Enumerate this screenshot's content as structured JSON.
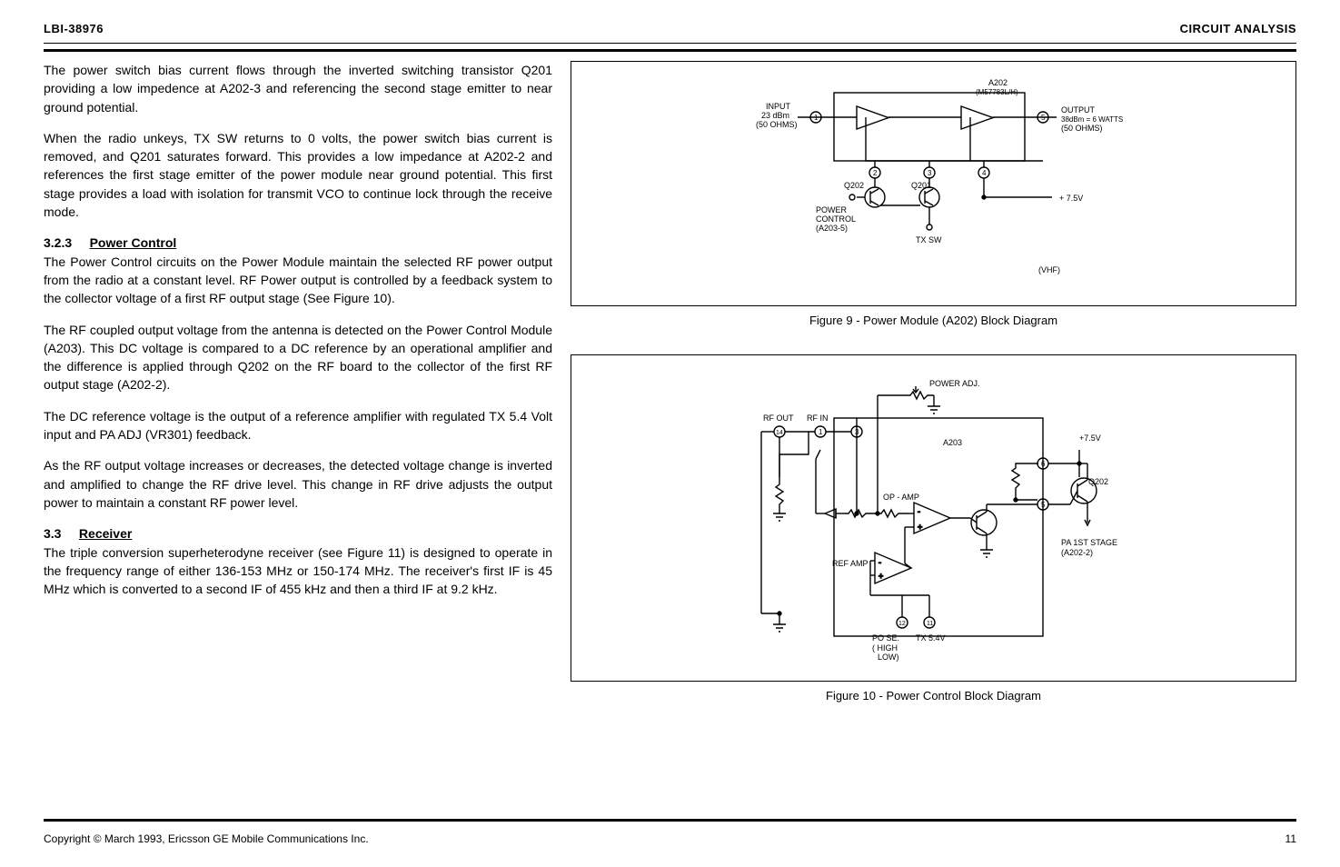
{
  "header": {
    "left": "LBI-38976",
    "right": "CIRCUIT ANALYSIS"
  },
  "body": {
    "p1": "The power switch bias current flows through the inverted switching transistor Q201 providing a low impedence at A202-3 and referencing the second stage emitter to near ground potential.",
    "p2": "When the radio unkeys, TX SW returns to 0 volts, the power switch bias current is removed, and Q201 saturates forward. This provides a low impedance at A202-2 and references the first stage emitter of the power module near ground potential. This first stage provides a load with isolation for transmit VCO to continue lock through the receive mode.",
    "h_sec": "3.2.3",
    "h_title": "Power Control",
    "p3": "The Power Control circuits on the Power Module maintain the selected RF power output from the radio at a constant level. RF Power output is controlled by a feedback system to the collector voltage of a first RF output stage (See Figure 10).",
    "p4": "The RF coupled output voltage from the antenna is detected on the Power Control Module (A203). This DC voltage is compared to a DC reference by an operational amplifier and the difference is applied through Q202 on the RF board to the collector of the first RF output stage (A202-2).",
    "p5": "The DC reference voltage is the output of a reference amplifier with regulated TX 5.4 Volt input and PA ADJ (VR301) feedback.",
    "p6": "As the RF output voltage increases or decreases, the detected voltage change is inverted and amplified to change the RF drive level. This change in RF drive adjusts the output power to maintain a constant RF power level.",
    "h_sec2": "3.3",
    "h_title2": "Receiver",
    "p7": "The triple conversion superheterodyne receiver (see Figure 11) is designed to operate in the frequency range of either 136-153 MHz or 150-174 MHz. The receiver's first IF is 45 MHz which is converted to a second IF of 455 kHz and then a third IF at 9.2 kHz."
  },
  "fig9": {
    "caption": "Figure 9 - Power Module (A202) Block Diagram",
    "labels": {
      "a202": "A202",
      "part": "(M57783L/H)",
      "input": "INPUT",
      "input_dbm": "23 dBm",
      "input_ohms": "(50 OHMS)",
      "output": "OUTPUT",
      "output_dbm": "38dBm = 6 WATTS",
      "output_ohms": "(50 OHMS)",
      "q202": "Q202",
      "q201": "Q201",
      "power_control": "POWER",
      "power_control2": "CONTROL",
      "a203_5": "(A203-5)",
      "tx_sw": "TX SW",
      "v75": "+ 7.5V",
      "vhf": "(VHF)"
    }
  },
  "fig10": {
    "caption": "Figure 10 - Power Control Block Diagram",
    "labels": {
      "rf_out": "RF OUT",
      "rf_in": "RF IN",
      "power_adj": "POWER ADJ.",
      "a203": "A203",
      "opamp": "OP - AMP",
      "refamp": "REF AMP",
      "q202": "Q202",
      "v75": "+7.5V",
      "pa1st": "PA 1ST STAGE",
      "a2022": "(A202-2)",
      "pose": "PO SE.",
      "tx54": "TX 5.4V",
      "highlow": "( HIGH",
      "low": "LOW)"
    }
  },
  "footer": {
    "left": "Copyright © March 1993, Ericsson GE Mobile Communications Inc.",
    "right": "11"
  }
}
